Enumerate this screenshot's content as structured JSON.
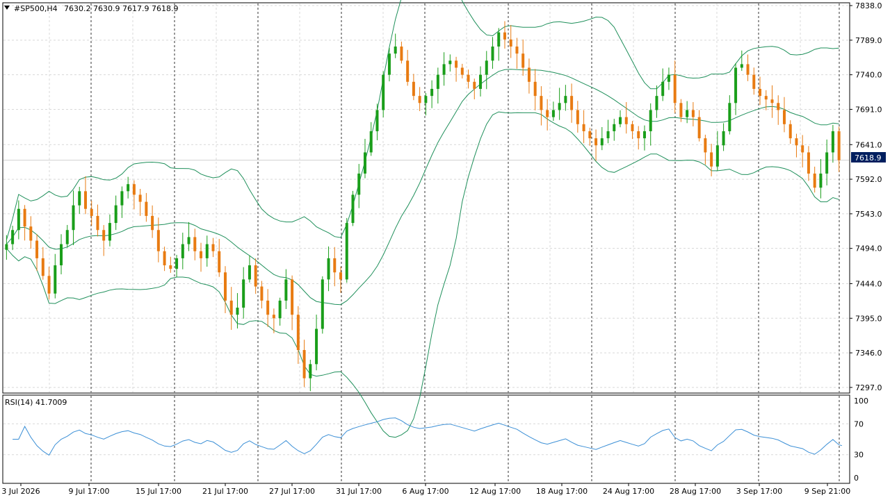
{
  "header": {
    "symbol": "#SP500,H4",
    "ohlc": "7630.2 7630.9 7617.9 7618.9"
  },
  "price_badge": "7618.9",
  "rsi_header": "RSI(14) 41.7009",
  "colors": {
    "bull": "#1a9e1a",
    "bear": "#e87b12",
    "bands": "#1e8f5a",
    "rsi": "#3b8fd6",
    "grid": "#d8d8d8",
    "badge_bg": "#001f5f",
    "frame": "#000000"
  },
  "chart_data": [
    {
      "type": "candlestick",
      "name": "price",
      "y_ticks": [
        "7838.0",
        "7789.0",
        "7740.0",
        "7691.0",
        "7641.0",
        "7592.0",
        "7543.0",
        "7494.0",
        "7444.0",
        "7395.0",
        "7346.0",
        "7297.0"
      ],
      "ylim": [
        7290,
        7841
      ],
      "x_ticks": [
        "3 Jul 2026",
        "9 Jul 17:00",
        "15 Jul 17:00",
        "21 Jul 17:00",
        "27 Jul 17:00",
        "31 Jul 17:00",
        "6 Aug 17:00",
        "12 Aug 17:00",
        "18 Aug 17:00",
        "24 Aug 17:00",
        "28 Aug 17:00",
        "3 Sep 17:00",
        "9 Sep 21:00"
      ],
      "close_path": [
        7500,
        7520,
        7550,
        7525,
        7505,
        7480,
        7455,
        7430,
        7470,
        7500,
        7520,
        7555,
        7575,
        7550,
        7540,
        7520,
        7505,
        7530,
        7555,
        7575,
        7585,
        7570,
        7560,
        7540,
        7520,
        7490,
        7470,
        7465,
        7480,
        7500,
        7510,
        7490,
        7480,
        7500,
        7490,
        7460,
        7420,
        7400,
        7410,
        7450,
        7470,
        7440,
        7420,
        7400,
        7395,
        7420,
        7450,
        7400,
        7350,
        7310,
        7330,
        7380,
        7450,
        7480,
        7460,
        7450,
        7530,
        7570,
        7600,
        7630,
        7660,
        7690,
        7740,
        7770,
        7780,
        7760,
        7730,
        7710,
        7700,
        7710,
        7720,
        7740,
        7755,
        7760,
        7750,
        7740,
        7730,
        7720,
        7740,
        7760,
        7780,
        7800,
        7790,
        7780,
        7770,
        7750,
        7730,
        7710,
        7690,
        7680,
        7690,
        7700,
        7710,
        7690,
        7670,
        7660,
        7650,
        7640,
        7650,
        7660,
        7670,
        7680,
        7670,
        7660,
        7650,
        7660,
        7690,
        7710,
        7730,
        7740,
        7700,
        7680,
        7690,
        7680,
        7650,
        7630,
        7610,
        7640,
        7660,
        7700,
        7750,
        7755,
        7740,
        7720,
        7710,
        7705,
        7700,
        7690,
        7670,
        7650,
        7640,
        7630,
        7600,
        7580,
        7600,
        7630,
        7660,
        7619
      ],
      "bollinger": true,
      "last_price": 7618.9
    },
    {
      "type": "line",
      "name": "RSI(14)",
      "y_ticks": [
        "100",
        "70",
        "30",
        "0"
      ],
      "ylim": [
        0,
        100
      ],
      "levels": [
        70,
        30
      ],
      "last_value": 41.7009
    }
  ]
}
